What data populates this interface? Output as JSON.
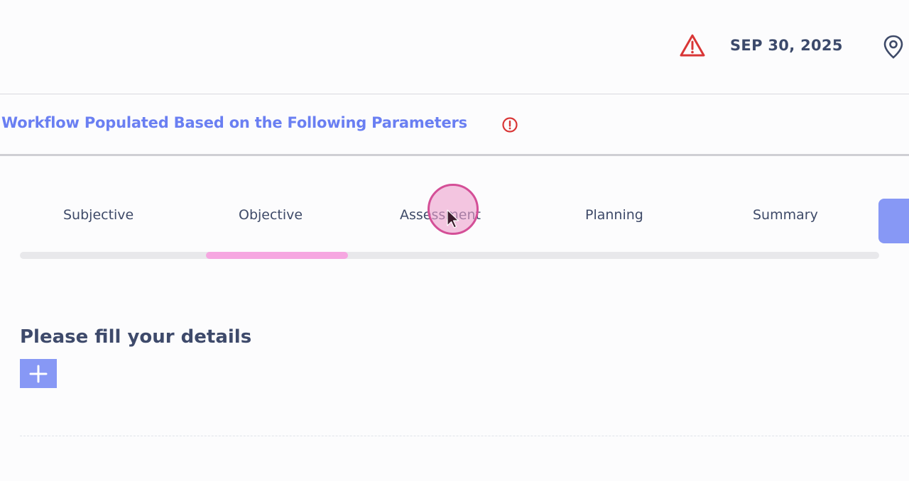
{
  "header": {
    "date": "SEP 30, 2025",
    "alert_icon": "warning-triangle-icon",
    "location_icon": "map-pin-icon"
  },
  "banner": {
    "title": "Workflow Populated Based on the Following Parameters",
    "info_icon": "exclamation-circle-icon"
  },
  "tabs": [
    {
      "label": "Subjective",
      "active": false
    },
    {
      "label": "Objective",
      "active": true
    },
    {
      "label": "Assessment",
      "active": false
    },
    {
      "label": "Planning",
      "active": false
    },
    {
      "label": "Summary",
      "active": false
    }
  ],
  "details": {
    "title": "Please fill your details",
    "add_icon": "plus-icon"
  },
  "colors": {
    "accent": "#6a7ff2",
    "button": "#8798f5",
    "active_tab_indicator": "#f6a7e1",
    "alert": "#d93636",
    "text": "#3e4a68"
  }
}
